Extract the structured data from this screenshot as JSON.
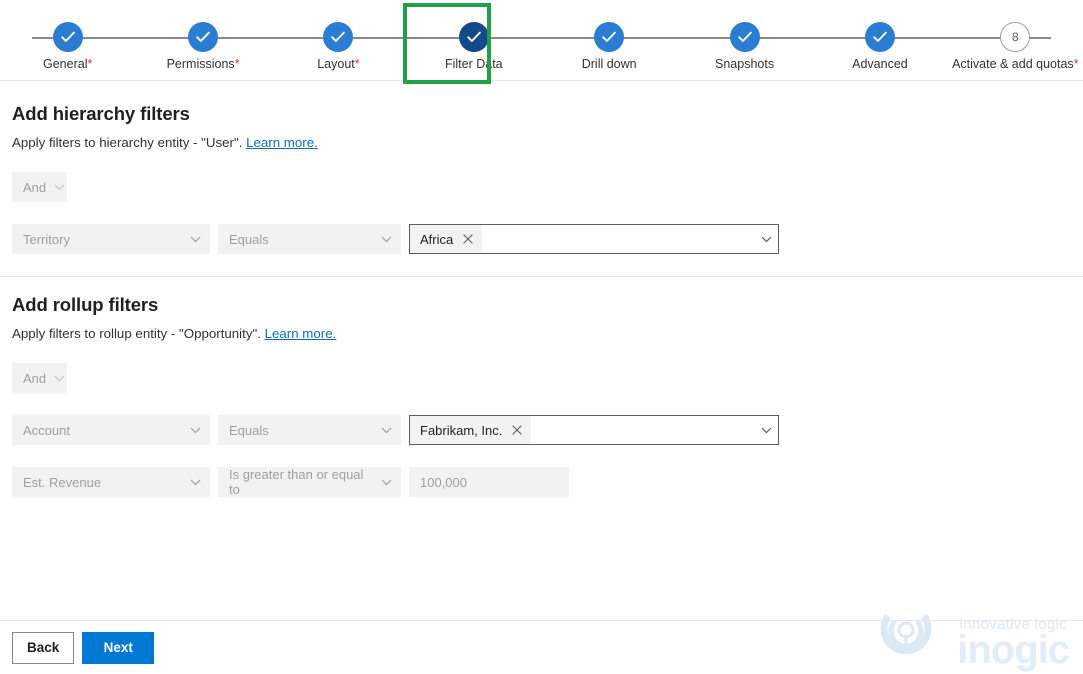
{
  "stepper": {
    "steps": [
      {
        "label": "General",
        "required": true,
        "state": "complete",
        "icon": "check-icon"
      },
      {
        "label": "Permissions",
        "required": true,
        "state": "complete",
        "icon": "check-icon"
      },
      {
        "label": "Layout",
        "required": true,
        "state": "complete",
        "icon": "check-icon"
      },
      {
        "label": "Filter Data",
        "required": false,
        "state": "active",
        "icon": "check-icon"
      },
      {
        "label": "Drill down",
        "required": false,
        "state": "complete",
        "icon": "check-icon"
      },
      {
        "label": "Snapshots",
        "required": false,
        "state": "complete",
        "icon": "check-icon"
      },
      {
        "label": "Advanced",
        "required": false,
        "state": "complete",
        "icon": "check-icon"
      },
      {
        "label": "Activate & add quotas",
        "required": true,
        "state": "pending",
        "number": "8"
      }
    ],
    "highlight_color": "#21a04a",
    "active_color": "#154a8a",
    "complete_color": "#2b7cd3"
  },
  "hierarchy_section": {
    "title": "Add hierarchy filters",
    "description_prefix": "Apply filters to hierarchy entity - \"User\". ",
    "learn_more": "Learn more.",
    "conjunction": "And",
    "row": {
      "field": "Territory",
      "operator": "Equals",
      "value_chip": "Africa"
    }
  },
  "rollup_section": {
    "title": "Add rollup filters",
    "description_prefix": "Apply filters to rollup entity - \"Opportunity\". ",
    "learn_more": "Learn more.",
    "conjunction": "And",
    "rows": [
      {
        "field": "Account",
        "operator": "Equals",
        "value_chip": "Fabrikam, Inc."
      },
      {
        "field": "Est. Revenue",
        "operator": "Is greater than or equal to",
        "value": "100,000"
      }
    ]
  },
  "footer": {
    "back_label": "Back",
    "next_label": "Next",
    "primary_color": "#0078d4"
  },
  "watermark": {
    "tagline": "innovative logic",
    "wordmark": "inogic"
  }
}
